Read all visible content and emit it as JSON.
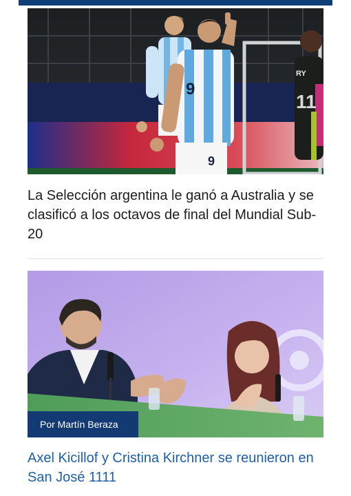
{
  "articles": [
    {
      "photo_alt": "jugadores-seleccion-argentina-sub20",
      "jersey_number": "9",
      "opponent_jersey_text": "RY",
      "headline": "La Selección argentina le ganó a Australia y se clasificó a los octavos de final del Mundial Sub-20"
    },
    {
      "photo_alt": "kicillof-kirchner-san-jose-1111",
      "author": "Por Martín Beraza",
      "headline": "Axel Kicillof y Cristina Kirchner se reunieron en San José 1111"
    }
  ],
  "colors": {
    "brand_navy": "#0f3f78",
    "badge_bg": "#143a73",
    "link_blue": "#1f5fa6",
    "headline_text": "#1c1c1c"
  }
}
